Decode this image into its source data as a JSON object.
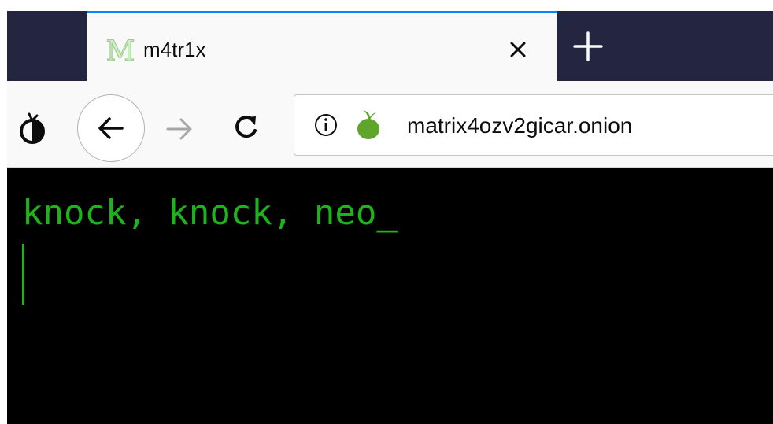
{
  "browser": {
    "tab": {
      "title": "m4tr1x",
      "favicon": "matrix-m-icon",
      "close_icon": "close-icon"
    },
    "new_tab_icon": "plus-icon",
    "nav": {
      "tor_icon": "tor-onion-icon",
      "back_icon": "back-arrow-icon",
      "forward_icon": "forward-arrow-icon",
      "reload_icon": "reload-icon"
    },
    "address_bar": {
      "info_icon": "info-icon",
      "security_icon": "onion-icon",
      "url": "matrix4ozv2gicar.onion"
    }
  },
  "page": {
    "line_1": "knock, knock, neo_"
  },
  "colors": {
    "tab_strip": "#232541",
    "active_tab_accent": "#0a84ff",
    "terminal_bg": "#000000",
    "terminal_text": "#1db31a",
    "onion_green": "#5fa52a"
  }
}
